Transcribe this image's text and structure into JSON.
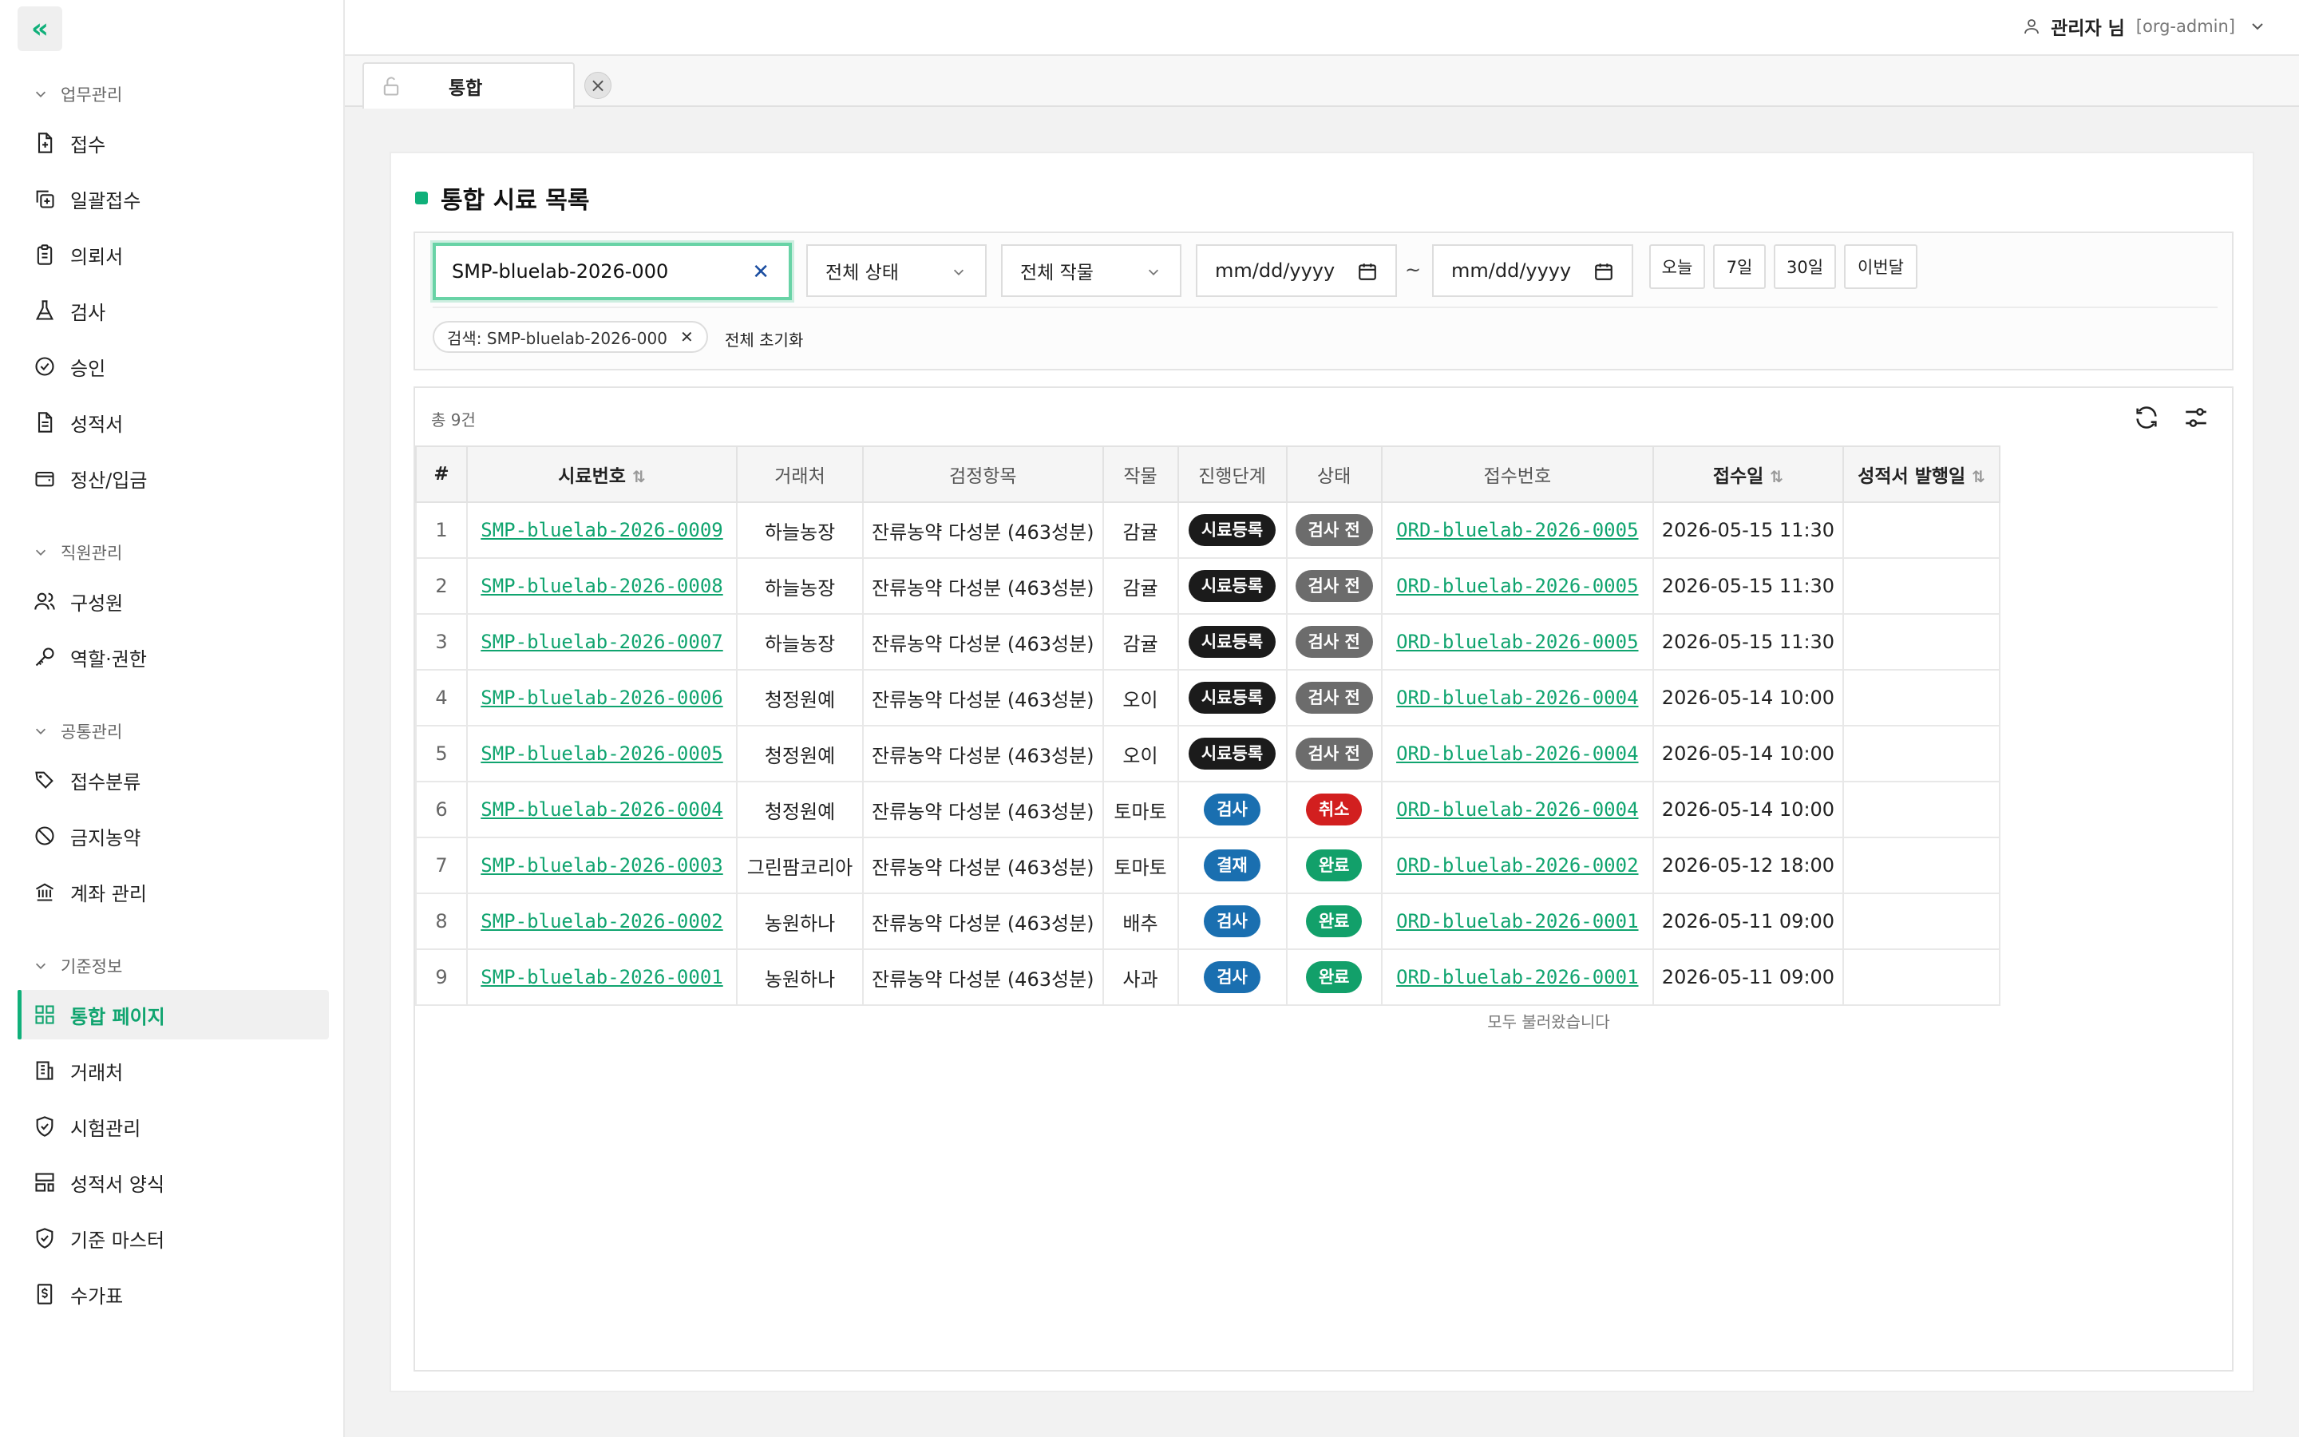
{
  "sidebar": {
    "groups": [
      {
        "title": "업무관리",
        "items": [
          {
            "label": "접수",
            "icon": "file-plus-icon"
          },
          {
            "label": "일괄접수",
            "icon": "copy-plus-icon"
          },
          {
            "label": "의뢰서",
            "icon": "clipboard-icon"
          },
          {
            "label": "검사",
            "icon": "flask-icon"
          },
          {
            "label": "승인",
            "icon": "check-circle-icon"
          },
          {
            "label": "성적서",
            "icon": "file-text-icon"
          },
          {
            "label": "정산/입금",
            "icon": "wallet-icon"
          }
        ]
      },
      {
        "title": "직원관리",
        "items": [
          {
            "label": "구성원",
            "icon": "users-icon"
          },
          {
            "label": "역할·권한",
            "icon": "key-icon"
          }
        ]
      },
      {
        "title": "공통관리",
        "items": [
          {
            "label": "접수분류",
            "icon": "tags-icon"
          },
          {
            "label": "금지농약",
            "icon": "ban-icon"
          },
          {
            "label": "계좌 관리",
            "icon": "bank-icon"
          }
        ]
      },
      {
        "title": "기준정보",
        "items": [
          {
            "label": "통합 페이지",
            "icon": "grid-icon",
            "active": true
          },
          {
            "label": "거래처",
            "icon": "building-icon"
          },
          {
            "label": "시험관리",
            "icon": "shield-check-icon"
          },
          {
            "label": "성적서 양식",
            "icon": "layout-template-icon"
          },
          {
            "label": "기준 마스터",
            "icon": "shield-check-icon"
          },
          {
            "label": "수가표",
            "icon": "dollar-file-icon"
          }
        ]
      }
    ]
  },
  "header": {
    "user_name": "관리자 님",
    "user_role": "[org-admin]"
  },
  "tabs": [
    {
      "label": "통합"
    }
  ],
  "page": {
    "title": "통합 시료 목록"
  },
  "filters": {
    "search_value": "SMP-bluelab-2026-000",
    "status_select": "전체 상태",
    "crop_select": "전체 작물",
    "date_from_placeholder": "mm/dd/yyyy",
    "date_to_placeholder": "mm/dd/yyyy",
    "tilde": "~",
    "quick": [
      "오늘",
      "7일",
      "30일",
      "이번달"
    ],
    "chip_label": "검색: SMP-bluelab-2026-000",
    "reset_label": "전체 초기화"
  },
  "list": {
    "count_label": "총 9건",
    "end_message": "모두 불러왔습니다",
    "columns": [
      "#",
      "시료번호",
      "거래처",
      "검정항목",
      "작물",
      "진행단계",
      "상태",
      "접수번호",
      "접수일",
      "성적서 발행일"
    ],
    "rows": [
      {
        "no": "1",
        "sample": "SMP-bluelab-2026-0009",
        "client": "하늘농장",
        "item": "잔류농약 다성분 (463성분)",
        "crop": "감귤",
        "stage": "시료등록",
        "stage_color": "black",
        "status": "검사 전",
        "status_color": "gray",
        "order": "ORD-bluelab-2026-0005",
        "received": "2026-05-15 11:30",
        "issued": ""
      },
      {
        "no": "2",
        "sample": "SMP-bluelab-2026-0008",
        "client": "하늘농장",
        "item": "잔류농약 다성분 (463성분)",
        "crop": "감귤",
        "stage": "시료등록",
        "stage_color": "black",
        "status": "검사 전",
        "status_color": "gray",
        "order": "ORD-bluelab-2026-0005",
        "received": "2026-05-15 11:30",
        "issued": ""
      },
      {
        "no": "3",
        "sample": "SMP-bluelab-2026-0007",
        "client": "하늘농장",
        "item": "잔류농약 다성분 (463성분)",
        "crop": "감귤",
        "stage": "시료등록",
        "stage_color": "black",
        "status": "검사 전",
        "status_color": "gray",
        "order": "ORD-bluelab-2026-0005",
        "received": "2026-05-15 11:30",
        "issued": ""
      },
      {
        "no": "4",
        "sample": "SMP-bluelab-2026-0006",
        "client": "청정원예",
        "item": "잔류농약 다성분 (463성분)",
        "crop": "오이",
        "stage": "시료등록",
        "stage_color": "black",
        "status": "검사 전",
        "status_color": "gray",
        "order": "ORD-bluelab-2026-0004",
        "received": "2026-05-14 10:00",
        "issued": ""
      },
      {
        "no": "5",
        "sample": "SMP-bluelab-2026-0005",
        "client": "청정원예",
        "item": "잔류농약 다성분 (463성분)",
        "crop": "오이",
        "stage": "시료등록",
        "stage_color": "black",
        "status": "검사 전",
        "status_color": "gray",
        "order": "ORD-bluelab-2026-0004",
        "received": "2026-05-14 10:00",
        "issued": ""
      },
      {
        "no": "6",
        "sample": "SMP-bluelab-2026-0004",
        "client": "청정원예",
        "item": "잔류농약 다성분 (463성분)",
        "crop": "토마토",
        "stage": "검사",
        "stage_color": "blue",
        "status": "취소",
        "status_color": "red",
        "order": "ORD-bluelab-2026-0004",
        "received": "2026-05-14 10:00",
        "issued": ""
      },
      {
        "no": "7",
        "sample": "SMP-bluelab-2026-0003",
        "client": "그린팜코리아",
        "item": "잔류농약 다성분 (463성분)",
        "crop": "토마토",
        "stage": "결재",
        "stage_color": "blue",
        "status": "완료",
        "status_color": "green",
        "order": "ORD-bluelab-2026-0002",
        "received": "2026-05-12 18:00",
        "issued": ""
      },
      {
        "no": "8",
        "sample": "SMP-bluelab-2026-0002",
        "client": "농원하나",
        "item": "잔류농약 다성분 (463성분)",
        "crop": "배추",
        "stage": "검사",
        "stage_color": "blue",
        "status": "완료",
        "status_color": "green",
        "order": "ORD-bluelab-2026-0001",
        "received": "2026-05-11 09:00",
        "issued": ""
      },
      {
        "no": "9",
        "sample": "SMP-bluelab-2026-0001",
        "client": "농원하나",
        "item": "잔류농약 다성분 (463성분)",
        "crop": "사과",
        "stage": "검사",
        "stage_color": "blue",
        "status": "완료",
        "status_color": "green",
        "order": "ORD-bluelab-2026-0001",
        "received": "2026-05-11 09:00",
        "issued": ""
      }
    ]
  },
  "colors": {
    "accent": "#10b07a",
    "link": "#10a46f"
  }
}
